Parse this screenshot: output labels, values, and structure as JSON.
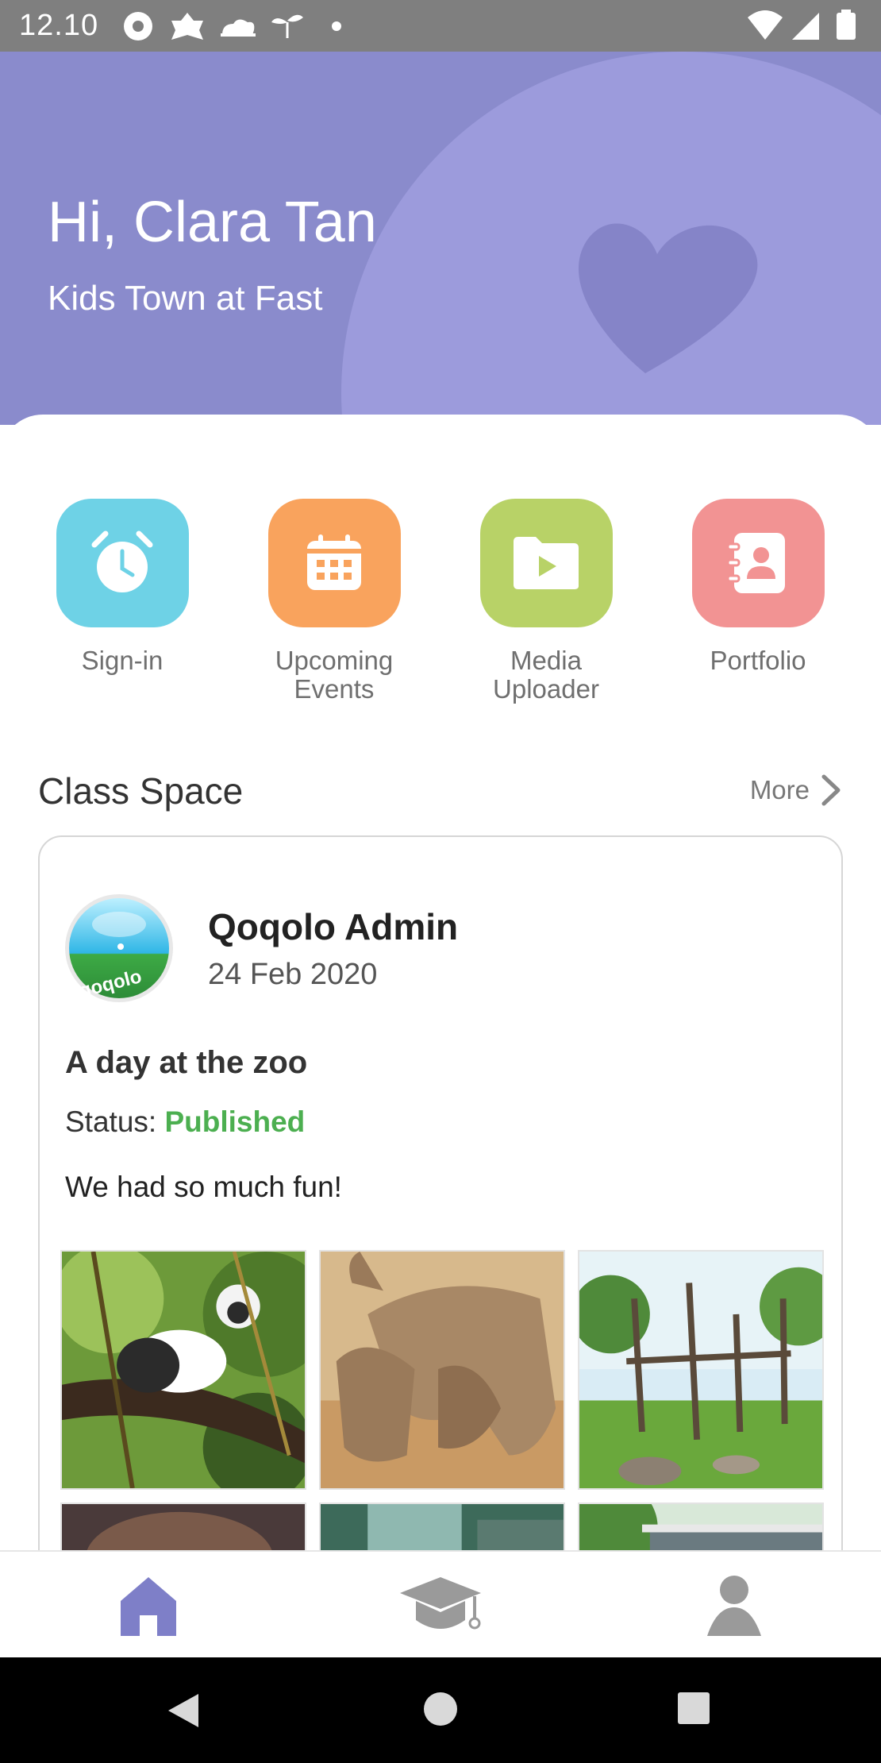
{
  "status_bar": {
    "time": "12.10",
    "left_icons": [
      "notification-icon",
      "settings-flower-icon",
      "cloud-icon",
      "seedling-icon",
      "dot-icon"
    ],
    "right_icons": [
      "wifi-icon",
      "signal-icon",
      "battery-icon"
    ]
  },
  "header": {
    "greeting": "Hi, Clara Tan",
    "school": "Kids Town at Fast",
    "bg_color": "#8a8bcc",
    "circle_color": "#9c9bdc",
    "heart_icon": "heart-icon"
  },
  "quick_actions": [
    {
      "label": "Sign-in",
      "icon": "alarm-clock-icon",
      "color": "#6ed2e6"
    },
    {
      "label": "Upcoming\nEvents",
      "icon": "calendar-icon",
      "color": "#f9a35d"
    },
    {
      "label": "Media\nUploader",
      "icon": "video-folder-icon",
      "color": "#b8d267"
    },
    {
      "label": "Portfolio",
      "icon": "contact-book-icon",
      "color": "#f29393"
    }
  ],
  "class_space": {
    "title": "Class Space",
    "more_label": "More",
    "post": {
      "author": "Qoqolo Admin",
      "avatar_text": "qoqolo",
      "date": "24 Feb 2020",
      "title": "A day at the zoo",
      "status_label": "Status: ",
      "status_value": "Published",
      "status_color": "#4caf50",
      "body": "We had so much fun!",
      "photos": [
        "monkey-photo",
        "rhinos-photo",
        "zoo-enclosure-photo",
        "animal-photo",
        "waterfall-photo",
        "building-photo"
      ]
    }
  },
  "bottom_nav": {
    "items": [
      "home-icon",
      "graduation-cap-icon",
      "profile-icon"
    ],
    "active": "home-icon",
    "active_color": "#7e7fc8"
  },
  "system_nav": [
    "back-icon",
    "home-circle-icon",
    "recents-icon"
  ]
}
